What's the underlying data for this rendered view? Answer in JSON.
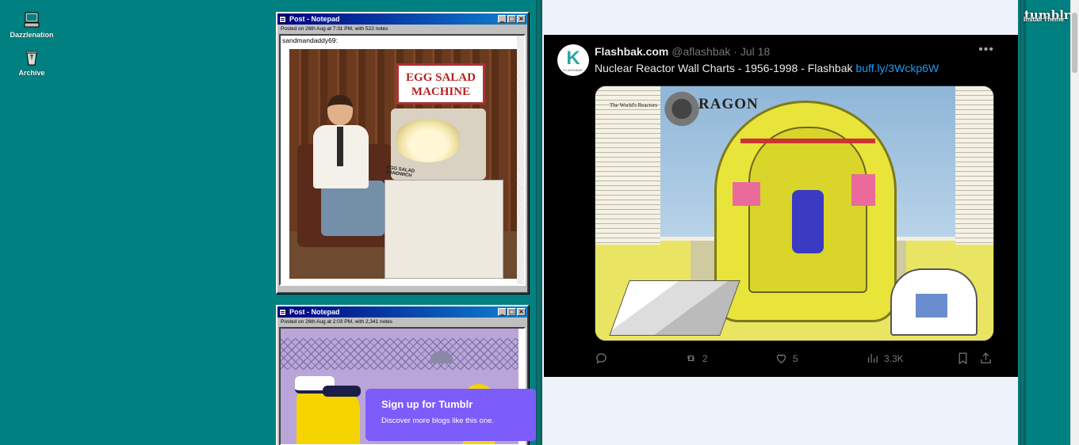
{
  "desktop": {
    "icons": [
      {
        "label": "Dazzlenation",
        "icon": "computer-icon"
      },
      {
        "label": "Archive",
        "icon": "recycle-bin-icon"
      }
    ]
  },
  "posts": [
    {
      "window_title": "Post - Notepad",
      "meta": "Posted on 26th Aug at 7:31 PM, with 522 notes",
      "author": "sandmandaddy69:",
      "image": {
        "sign_line1": "EGG SALAD",
        "sign_line2": "MACHINE",
        "caption": "EGG SALAD SANDWICH"
      }
    },
    {
      "window_title": "Post - Notepad",
      "meta": "Posted on 26th Aug at 2:03 PM, with 2,341 notes"
    }
  ],
  "signup": {
    "title": "Sign up for Tumblr",
    "subtitle": "Discover more blogs like this one."
  },
  "tweet": {
    "name": "Flashbak.com",
    "handle": "@aflashbak",
    "separator": " · ",
    "date": "Jul 18",
    "text": "Nuclear Reactor Wall Charts - 1956-1998 - Flashbak ",
    "link": "buff.ly/3Wckp6W",
    "avatar_letter": "K",
    "avatar_caption": "FLASHBAK",
    "media": {
      "title_word": "RAGON",
      "chart_heading": "The World's Reactors"
    },
    "actions": {
      "reply": "",
      "retweet": "2",
      "like": "5",
      "views": "3.3K"
    }
  },
  "theme": {
    "logo": "tumblr",
    "install_label": "Install Theme"
  },
  "colors": {
    "desktop": "#008080",
    "titlebar": "#000080",
    "signup": "#7c5cfa",
    "tweet_link": "#1d9bf0"
  }
}
